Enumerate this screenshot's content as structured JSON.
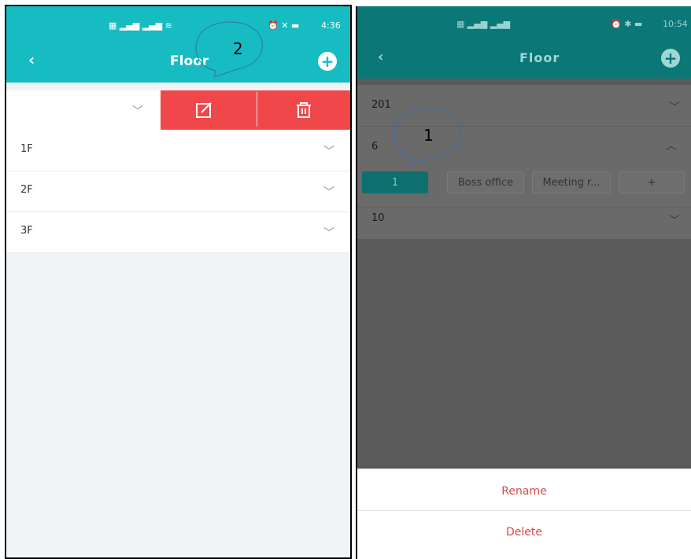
{
  "left_screen": {
    "status_bar": {
      "time": "4:36"
    },
    "header": {
      "title": "Floor",
      "back_icon": "chevron-left-icon",
      "add_icon": "plus-circle-icon"
    },
    "swiped_row": {
      "edit_icon": "edit-icon",
      "delete_icon": "trash-icon"
    },
    "floors": [
      {
        "label": "1F"
      },
      {
        "label": "2F"
      },
      {
        "label": "3F"
      }
    ],
    "callout": {
      "number": "2"
    },
    "colors": {
      "header": "#16bcc2",
      "swipe": "#f0484a"
    }
  },
  "right_screen": {
    "status_bar": {
      "time": "10:54"
    },
    "header": {
      "title": "Floor",
      "back_icon": "chevron-left-icon",
      "add_icon": "plus-circle-icon"
    },
    "floors": [
      {
        "label": "201",
        "expanded": false
      },
      {
        "label": "6",
        "expanded": true
      },
      {
        "label": "10",
        "expanded": false
      }
    ],
    "rooms": [
      {
        "label": "1",
        "active": true
      },
      {
        "label": "Boss office",
        "active": false
      },
      {
        "label": "Meeting r...",
        "active": false
      },
      {
        "label": "+",
        "active": false
      }
    ],
    "action_sheet": {
      "rename": "Rename",
      "delete": "Delete"
    },
    "callout": {
      "number": "1"
    },
    "colors": {
      "header": "#0c7777",
      "action": "#d44a4a"
    }
  }
}
